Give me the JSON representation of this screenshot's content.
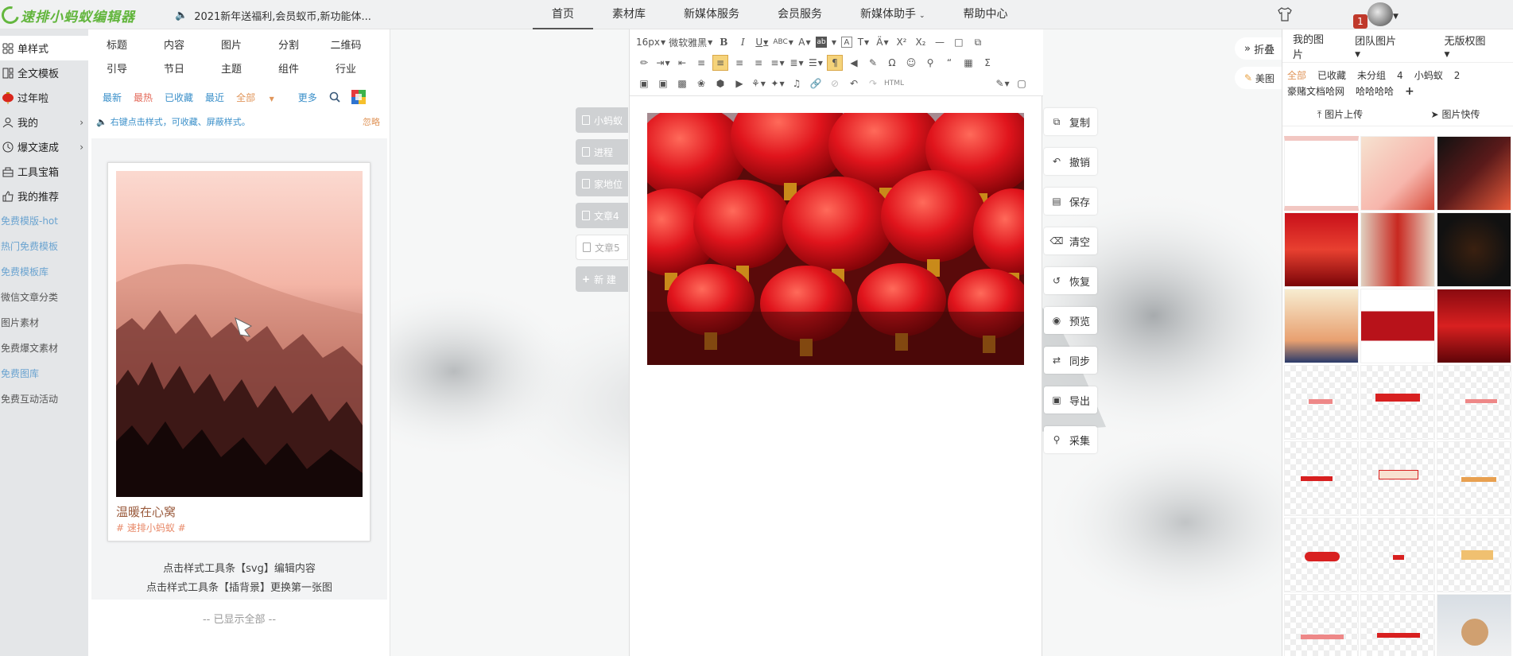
{
  "header": {
    "logo_text": "速排小蚂蚁编辑器",
    "notice": "2021新年送福利,会员蚁币,新功能体...",
    "nav": [
      "首页",
      "素材库",
      "新媒体服务",
      "会员服务",
      "新媒体助手",
      "帮助中心"
    ],
    "notification_count": "1"
  },
  "sidebar": {
    "items": [
      {
        "label": "单样式",
        "icon": "grid-icon"
      },
      {
        "label": "全文模板",
        "icon": "template-icon"
      },
      {
        "label": "过年啦",
        "icon": "lantern-icon"
      },
      {
        "label": "我的",
        "icon": "user-icon"
      },
      {
        "label": "爆文速成",
        "icon": "clock-icon"
      },
      {
        "label": "工具宝箱",
        "icon": "toolbox-icon"
      },
      {
        "label": "我的推荐",
        "icon": "thumbs-up-icon"
      }
    ],
    "links": [
      "免费模版-hot",
      "热门免费模板",
      "免费模板库",
      "微信文章分类",
      "图片素材",
      "免费爆文素材",
      "免费图库",
      "免费互动活动"
    ]
  },
  "style_panel": {
    "tabs_row1": [
      "标题",
      "内容",
      "图片",
      "分割",
      "二维码"
    ],
    "tabs_row2": [
      "引导",
      "节日",
      "主题",
      "组件",
      "行业"
    ],
    "filters": [
      "最新",
      "最热",
      "已收藏",
      "最近",
      "全部",
      "更多"
    ],
    "hint": "右键点击样式，可收藏、屏蔽样式。",
    "ignore": "忽略",
    "card": {
      "title": "温暖在心窝",
      "tag": "# 速排小蚂蚁 #"
    },
    "instructions": [
      "点击样式工具条【svg】编辑内容",
      "点击样式工具条【插背景】更换第一张图"
    ],
    "end_text": "-- 已显示全部 --"
  },
  "articles": [
    "小蚂蚁",
    "进程",
    "家地位",
    "文章4",
    "文章5",
    "新 建"
  ],
  "editor": {
    "font_size": "16px",
    "font_family": "微软雅黑",
    "html_label": "HTML"
  },
  "actions": [
    "复制",
    "撤销",
    "保存",
    "清空",
    "恢复",
    "预览",
    "同步",
    "导出",
    "采集"
  ],
  "right_panel": {
    "fold": "折叠",
    "meitu": "美图",
    "tabs": [
      "我的图片",
      "团队图片",
      "无版权图"
    ],
    "categories": [
      "全部",
      "已收藏",
      "未分组",
      "4",
      "小蚂蚁",
      "2",
      "豪赌文档哈网",
      "哈哈哈哈",
      "+"
    ],
    "upload": "图片上传",
    "quick": "图片快传"
  },
  "colors": {
    "accent_green": "#61b53b",
    "link_blue": "#6aa3d0",
    "filter_orange": "#e0955a",
    "highlight": "#f5d37a"
  }
}
